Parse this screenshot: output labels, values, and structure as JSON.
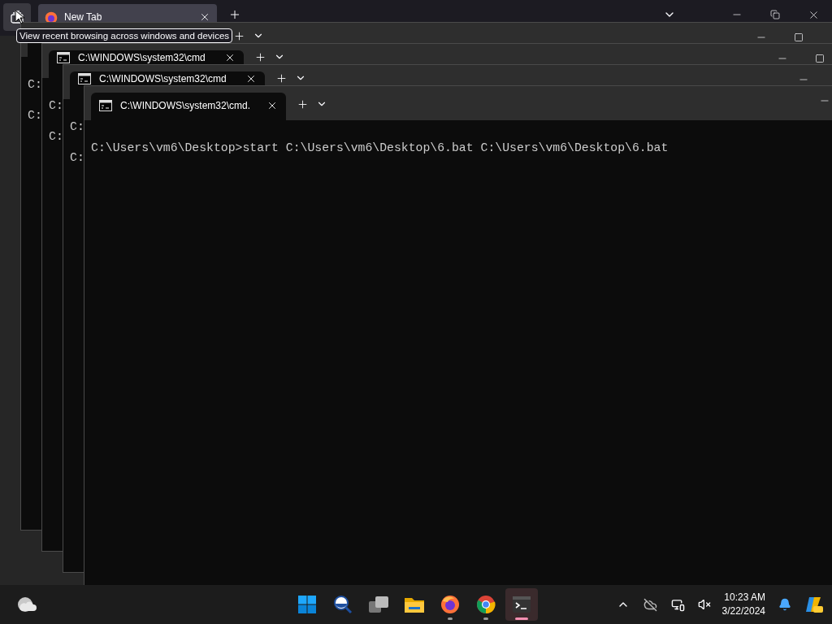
{
  "browser": {
    "tabs": [
      {
        "title": "New Tab",
        "selected": true
      }
    ],
    "tooltip": "View recent browsing across windows and devices"
  },
  "terminal_windows": [
    {
      "lines": [
        "C:",
        "C:"
      ],
      "controls": [
        {
          "kind": "minimize"
        },
        {
          "kind": "maximize"
        }
      ]
    },
    {
      "tab_title": "C:\\WINDOWS\\system32\\cmd",
      "lines": [
        "C:",
        "C:"
      ],
      "controls": [
        {
          "kind": "minimize"
        },
        {
          "kind": "maximize"
        }
      ]
    },
    {
      "tab_title": "C:\\WINDOWS\\system32\\cmd",
      "lines": [
        "C:",
        "C:"
      ],
      "controls": [
        {
          "kind": "minimize"
        }
      ]
    },
    {
      "tab_title": "C:\\WINDOWS\\system32\\cmd.",
      "lines": [
        "C:\\Users\\vm6\\Desktop>start C:\\Users\\vm6\\Desktop\\6.bat C:\\Users\\vm6\\Desktop\\6.bat"
      ],
      "controls": [
        {
          "kind": "minimize"
        }
      ]
    }
  ],
  "taskbar": {
    "apps": [
      {
        "kind": "start",
        "running": false,
        "selected": false
      },
      {
        "kind": "search",
        "running": false,
        "selected": false
      },
      {
        "kind": "taskview",
        "running": false,
        "selected": false
      },
      {
        "kind": "files",
        "running": false,
        "selected": false
      },
      {
        "kind": "firefox",
        "running": true,
        "selected": false
      },
      {
        "kind": "chrome",
        "running": true,
        "selected": false
      },
      {
        "kind": "terminal",
        "running": true,
        "selected": true
      }
    ],
    "time": "10:23 AM",
    "date": "3/22/2024"
  }
}
